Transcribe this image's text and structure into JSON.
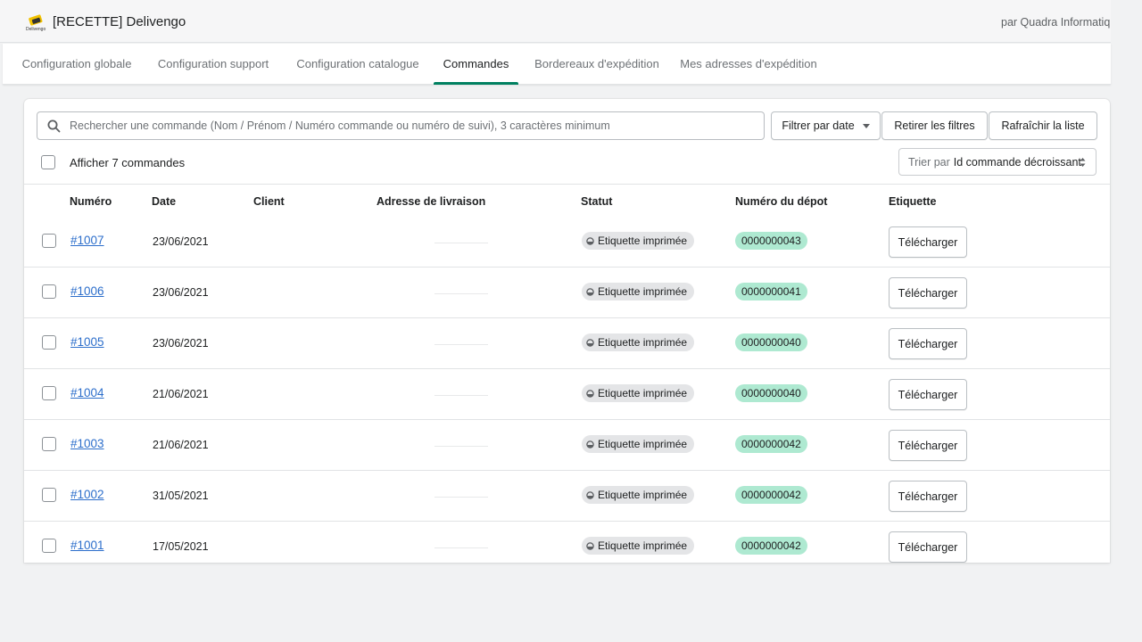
{
  "header": {
    "app_title": "[RECETTE] Delivengo",
    "logo_text": "Delivengo",
    "by_line": "par Quadra Informatique"
  },
  "tabs": [
    {
      "label": "Configuration globale"
    },
    {
      "label": "Configuration support"
    },
    {
      "label": "Configuration catalogue"
    },
    {
      "label": "Commandes"
    },
    {
      "label": "Bordereaux d'expédition"
    },
    {
      "label": "Mes adresses d'expédition"
    }
  ],
  "active_tab": "Commandes",
  "toolbar": {
    "search_placeholder": "Rechercher une commande (Nom / Prénom / Numéro commande ou numéro de suivi), 3 caractères minimum",
    "filter_date_label": "Filtrer par date",
    "clear_filters_label": "Retirer les filtres",
    "refresh_label": "Rafraîchir la liste"
  },
  "list": {
    "select_all_label": "Afficher 7 commandes",
    "sort_prefix": "Trier par",
    "sort_value": "Id commande décroissant"
  },
  "table": {
    "headers": {
      "number": "Numéro",
      "date": "Date",
      "client": "Client",
      "address": "Adresse de livraison",
      "status": "Statut",
      "depot": "Numéro du dépot",
      "label": "Etiquette"
    },
    "rows": [
      {
        "number": "#1007",
        "date": "23/06/2021",
        "status": "Etiquette imprimée",
        "depot": "0000000043",
        "action": "Télécharger"
      },
      {
        "number": "#1006",
        "date": "23/06/2021",
        "status": "Etiquette imprimée",
        "depot": "0000000041",
        "action": "Télécharger"
      },
      {
        "number": "#1005",
        "date": "23/06/2021",
        "status": "Etiquette imprimée",
        "depot": "0000000040",
        "action": "Télécharger"
      },
      {
        "number": "#1004",
        "date": "21/06/2021",
        "status": "Etiquette imprimée",
        "depot": "0000000040",
        "action": "Télécharger"
      },
      {
        "number": "#1003",
        "date": "21/06/2021",
        "status": "Etiquette imprimée",
        "depot": "0000000042",
        "action": "Télécharger"
      },
      {
        "number": "#1002",
        "date": "31/05/2021",
        "status": "Etiquette imprimée",
        "depot": "0000000042",
        "action": "Télécharger"
      },
      {
        "number": "#1001",
        "date": "17/05/2021",
        "status": "Etiquette imprimée",
        "depot": "0000000042",
        "action": "Télécharger"
      }
    ]
  },
  "colors": {
    "accent": "#008060",
    "link": "#2c6ecb",
    "depot_badge": "#aee9d1",
    "status_badge": "#e4e5e7"
  },
  "icons": {
    "logo": "delivengo-logo-icon",
    "search": "search-icon",
    "filter_caret": "caret-down-icon",
    "sort": "sort-arrows-icon",
    "status": "status-dot-icon"
  }
}
